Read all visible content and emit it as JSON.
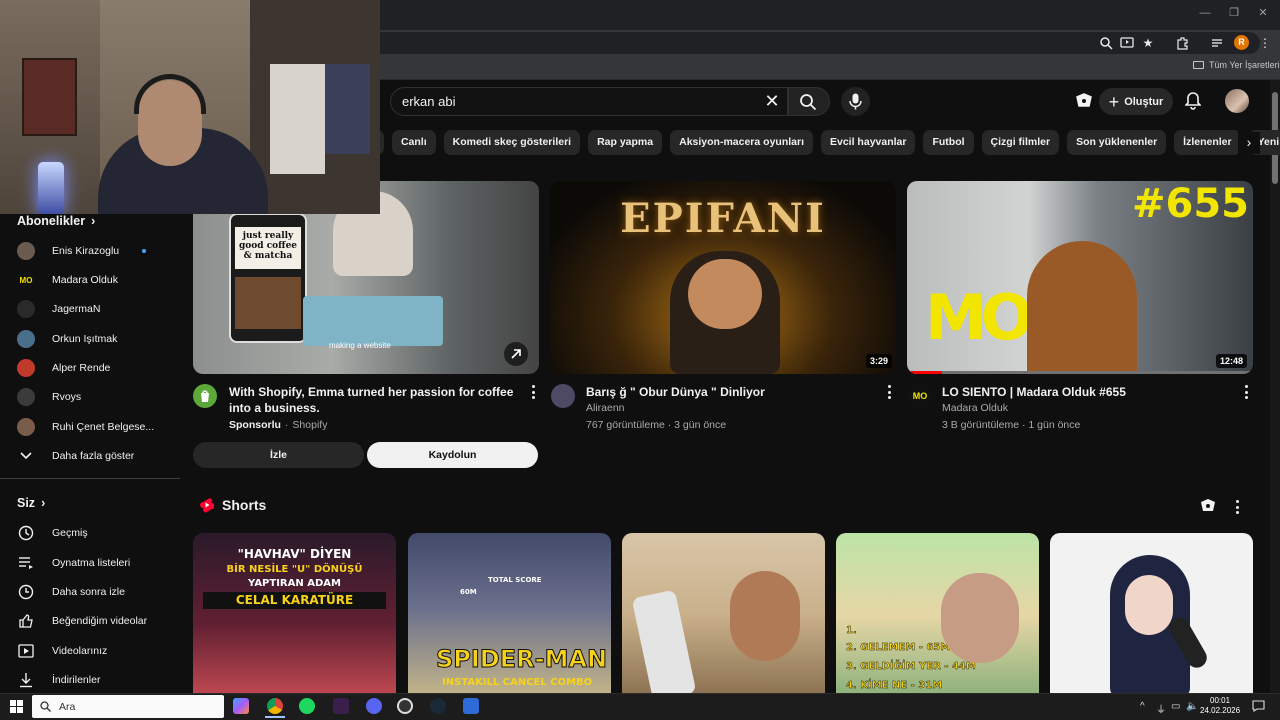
{
  "browser": {
    "window_controls": [
      "—",
      "❐",
      "✕"
    ],
    "toolbar_icons": [
      "zoom-icon",
      "cast-icon",
      "bookmark-star-icon",
      "extensions-icon",
      "reading-list-icon"
    ],
    "profile_initial": "R",
    "bookmarks_folder": "Tüm Yer İşaretleri"
  },
  "header": {
    "search_value": "erkan abi",
    "clear_symbol": "✕",
    "create_label": "Oluştur",
    "create_plus": "+"
  },
  "chips": [
    "er",
    "Canlı",
    "Komedi skeç gösterileri",
    "Rap yapma",
    "Aksiyon-macera oyunları",
    "Evcil hayvanlar",
    "Futbol",
    "Çizgi filmler",
    "Son yüklenenler",
    "İzlenenler",
    "Yeni"
  ],
  "chip_next": "›",
  "sidebar": {
    "subs_title": "Abonelikler",
    "subs_arrow": "›",
    "subs": [
      {
        "name": "Enis Kirazoglu",
        "color": "#6b5a4e"
      },
      {
        "name": "Madara Olduk",
        "color": "#111111"
      },
      {
        "name": "JagermaN",
        "color": "#2a2a2a"
      },
      {
        "name": "Orkun Işıtmak",
        "color": "#4a6f8a"
      },
      {
        "name": "Alper Rende",
        "color": "#c0392b"
      },
      {
        "name": "Rvoys",
        "color": "#3b3b3b"
      },
      {
        "name": "Ruhi Çenet Belgese...",
        "color": "#7a5c4a"
      }
    ],
    "show_more": "Daha fazla göster",
    "you_title": "Siz",
    "you_arrow": "›",
    "you_items": [
      {
        "label": "Geçmiş",
        "icon": "history-icon"
      },
      {
        "label": "Oynatma listeleri",
        "icon": "playlists-icon"
      },
      {
        "label": "Daha sonra izle",
        "icon": "watch-later-icon"
      },
      {
        "label": "Beğendiğim videolar",
        "icon": "liked-icon"
      },
      {
        "label": "Videolarınız",
        "icon": "your-videos-icon"
      },
      {
        "label": "İndirilenler",
        "icon": "downloads-icon"
      }
    ]
  },
  "ad": {
    "title": "With Shopify, Emma turned her passion for coffee into a business.",
    "sponsored": "Sponsorlu",
    "dot": "·",
    "advertiser": "Shopify",
    "thumb_sign": "just really good coffee & matcha",
    "thumb_caption": "making a website",
    "watch_label": "İzle",
    "signup_label": "Kaydolun"
  },
  "videos": [
    {
      "title": "Barış ğ \" Obur Dünya \" Dinliyor",
      "channel": "Aliraenn",
      "meta": "767 görüntüleme · 3 gün önce",
      "duration": "3:29",
      "thumb_text": "EPIFANI"
    },
    {
      "title": "LO SIENTO | Madara Olduk #655",
      "channel": "Madara Olduk",
      "meta": "3 B görüntüleme · 1 gün önce",
      "duration": "12:48",
      "thumb_text": "#655",
      "thumb_logo": "MO",
      "progress": 0.1
    }
  ],
  "shorts": {
    "title": "Shorts",
    "items": [
      {
        "line1": "\"HAVHAV\" DİYEN",
        "line2": "BİR NESİLE \"U\" DÖNÜŞÜ",
        "line3": "YAPTIRAN ADAM",
        "line4": "CELAL KARATÜRE"
      },
      {
        "line1": "SPIDER-MAN",
        "line2": "INSTAKILL CANCEL COMBO",
        "hud1": "TOTAL SCORE",
        "hud2": "60M"
      },
      {
        "line1": ""
      },
      {
        "line1": "1.",
        "line2": "2. GELEMEM - 65M",
        "line3": "3. GELDİĞİM YER - 44M",
        "line4": "4. KİME NE - 31M"
      },
      {
        "line1": ""
      }
    ]
  },
  "taskbar": {
    "search_placeholder": "Ara",
    "time": "00:01",
    "date": "24.02.2026",
    "tray": [
      "^",
      "⏚",
      "▭",
      "🔈"
    ]
  }
}
